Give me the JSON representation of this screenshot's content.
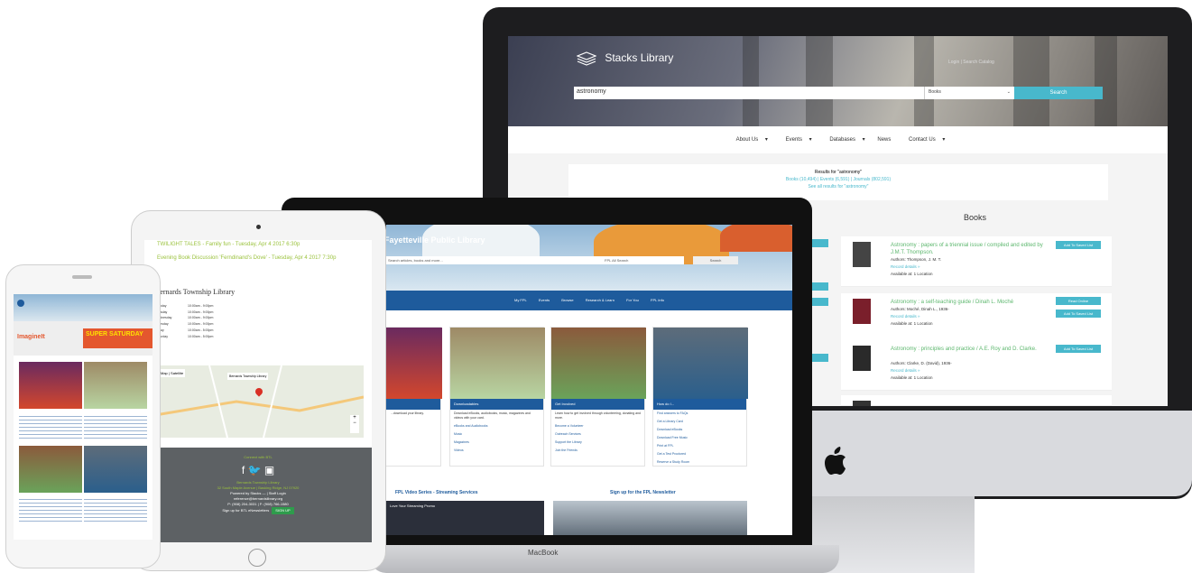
{
  "imac": {
    "logo": "Stacks Library",
    "search_value": "astronomy",
    "search_select": "Books",
    "search_button": "Search",
    "utility_links": "Login  |  Search Catalog",
    "nav": [
      "About Us",
      "Events",
      "Databases",
      "News",
      "Contact Us"
    ],
    "results_title": "Results for \"astronomy\"",
    "results_counts": "Books (10,494)  |  Events (6,591)  |  Journals (802,591)",
    "results_all": "See all results for \"astronomy\"",
    "books_heading": "Books",
    "books": [
      {
        "title": "Astronomy : papers of a triennial issue / compiled and edited by J.M.T. Thompson.",
        "authors": "Authors: Thompson, J. M. T.",
        "details": "Record details »",
        "available": "Available at: 1 Location",
        "buttons": [
          "Add To Saved List"
        ]
      },
      {
        "title": "Astronomy : a self-teaching guide / Dinah L. Moché",
        "authors": "Authors: Moché, Dinah L., 1936-",
        "details": "Record details »",
        "available": "Available at: 1 Location",
        "buttons": [
          "Read Online",
          "Add To Saved List"
        ]
      },
      {
        "title": "Astronomy : principles and practice / A.E. Roy and D. Clarke.",
        "authors": "Authors: Clarke, D. (David), 1936-",
        "details": "Record details »",
        "available": "Available at: 1 Location",
        "buttons": [
          "Add To Saved List"
        ]
      }
    ]
  },
  "macbook": {
    "site_title": "Fayetteville Public Library",
    "search_value": "Search articles, books and more...",
    "search_select": "FPL All Search",
    "search_button": "Search",
    "nav": [
      "My FPL",
      "Events",
      "Browse",
      "Research & Learn",
      "For You",
      "FPL Info"
    ],
    "cards": [
      {
        "title": "",
        "text": "...download your library."
      },
      {
        "title": "Downloadables",
        "text": "Download eBooks, audiobooks, music, magazines and videos with your card.",
        "links": [
          "eBooks and Audiobooks",
          "Music",
          "Magazines",
          "Videos"
        ]
      },
      {
        "title": "Get Involved",
        "text": "Learn how to get involved through volunteering, donating and more.",
        "links": [
          "Become a Volunteer",
          "Outreach Services",
          "Support the Library",
          "Join the Friends"
        ]
      },
      {
        "title": "How do I...",
        "links": [
          "Find answers to FAQs",
          "Get a Library Card",
          "Download eBooks",
          "Download Free Music",
          "Print at FPL",
          "Get a Test Proctored",
          "Reserve a Study Room"
        ]
      }
    ],
    "video_heading": "FPL Video Series - Streaming Services",
    "video_caption": "Love Your Streaming Promo",
    "newsletter_heading": "Sign up for the FPL Newsletter",
    "brand": "MacBook"
  },
  "ipad": {
    "events": [
      "TWILIGHT TALES - Family fun - Tuesday, Apr 4 2017 6:30p",
      "Evening Book Discussion 'Ferndinand's Dove' - Tuesday, Apr 4 2017 7:30p"
    ],
    "library_name": "Bernards Township Library",
    "hours": [
      {
        "day": "Monday",
        "time": "10:00am - 9:00pm"
      },
      {
        "day": "Tuesday",
        "time": "10:00am - 9:00pm"
      },
      {
        "day": "Wednesday",
        "time": "10:00am - 9:00pm"
      },
      {
        "day": "Thursday",
        "time": "10:00am - 9:00pm"
      },
      {
        "day": "Friday",
        "time": "10:00am - 5:00pm"
      },
      {
        "day": "Saturday",
        "time": "10:00am - 5:00pm"
      }
    ],
    "map_tabs": [
      "Map",
      "Satellite"
    ],
    "map_pin_label": "Bernards Township Library",
    "footer": {
      "connect": "Connect with BTL",
      "name": "Bernards Township Library",
      "address": "32 South Maple Avenue | Basking Ridge, NJ 07920",
      "powered": "Powered by Stacks — | Staff Login",
      "email": "reference@bernardslibrary.org",
      "phone": "P: (908) 204-3031 | F: (908) 766-1580",
      "newsletter": "Sign up for BTL eNewsletters",
      "signup": "SIGN UP"
    }
  },
  "phone": {
    "banner_text": "SUPER SATURDAY",
    "banner_logo": "ImagineIt"
  }
}
